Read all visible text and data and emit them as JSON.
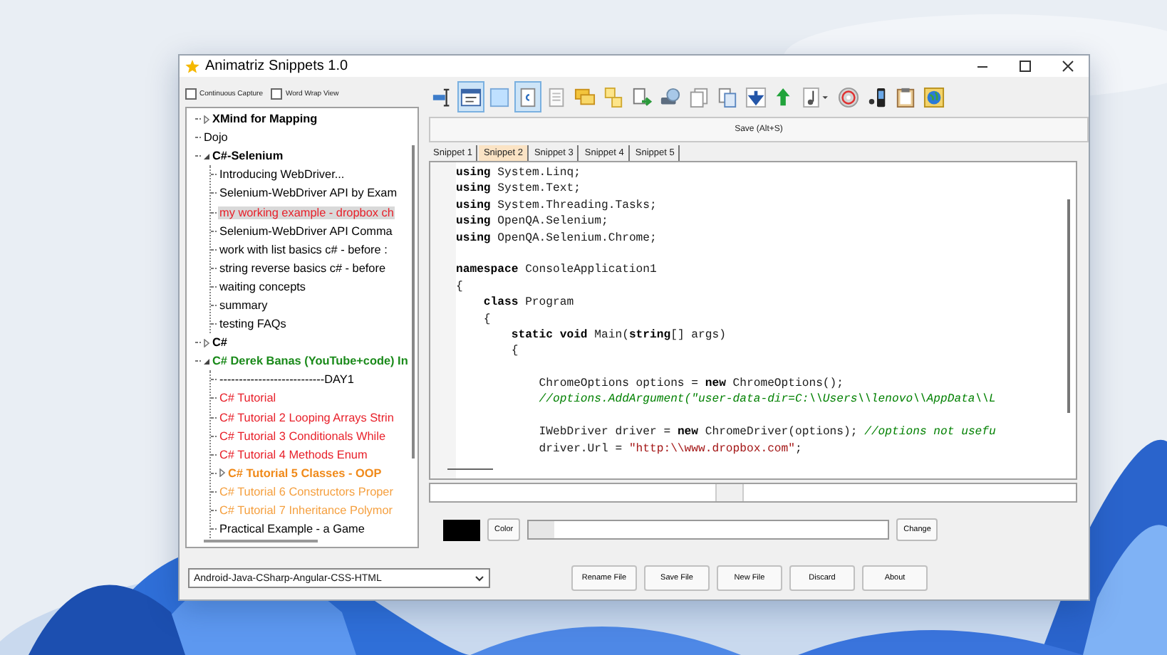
{
  "window": {
    "title": "Animatriz Snippets 1.0"
  },
  "options": [
    {
      "label": "Continuous Capture",
      "checked": false
    },
    {
      "label": "Word Wrap View",
      "checked": false
    }
  ],
  "tree": [
    {
      "label": "XMind for Mapping",
      "bold": true,
      "color": "#000000",
      "expanded": false,
      "selected": false
    },
    {
      "label": "Dojo",
      "bold": false,
      "color": "#000000",
      "selected": false
    },
    {
      "label": "C#-Selenium",
      "bold": true,
      "color": "#000000",
      "expanded": true,
      "selected": false,
      "children": [
        {
          "label": "Introducing WebDriver...",
          "bold": false,
          "color": "#000000",
          "selected": false
        },
        {
          "label": "Selenium-WebDriver API by Exam",
          "bold": false,
          "color": "#000000",
          "selected": false
        },
        {
          "label": "my working example - dropbox ch",
          "bold": false,
          "color": "#e8202a",
          "selected": true
        },
        {
          "label": "Selenium-WebDriver API Comma",
          "bold": false,
          "color": "#000000",
          "selected": false
        },
        {
          "label": "work with list basics c# - before :",
          "bold": false,
          "color": "#000000",
          "selected": false
        },
        {
          "label": "string reverse basics c# - before",
          "bold": false,
          "color": "#000000",
          "selected": false
        },
        {
          "label": "waiting concepts",
          "bold": false,
          "color": "#000000",
          "selected": false
        },
        {
          "label": "summary",
          "bold": false,
          "color": "#000000",
          "selected": false
        },
        {
          "label": "testing FAQs",
          "bold": false,
          "color": "#000000",
          "selected": false
        }
      ]
    },
    {
      "label": "C#",
      "bold": true,
      "color": "#000000",
      "expanded": false,
      "selected": false
    },
    {
      "label": "C# Derek Banas (YouTube+code) In",
      "bold": true,
      "color": "#1a8a1a",
      "expanded": true,
      "selected": false,
      "children": [
        {
          "label": "---------------------------DAY1",
          "bold": false,
          "color": "#000000",
          "selected": false
        },
        {
          "label": "C# Tutorial",
          "bold": false,
          "color": "#e8202a",
          "selected": false
        },
        {
          "label": "C# Tutorial 2 Looping Arrays Strin",
          "bold": false,
          "color": "#e8202a",
          "selected": false
        },
        {
          "label": "C# Tutorial 3 Conditionals While",
          "bold": false,
          "color": "#e8202a",
          "selected": false
        },
        {
          "label": "C# Tutorial 4 Methods Enum",
          "bold": false,
          "color": "#e8202a",
          "selected": false
        },
        {
          "label": "C# Tutorial 5 Classes - OOP",
          "bold": true,
          "color": "#f08a1a",
          "expanded": false,
          "selected": false
        },
        {
          "label": "C# Tutorial 6 Constructors Proper",
          "bold": false,
          "color": "#f5a040",
          "selected": false
        },
        {
          "label": "C# Tutorial 7 Inheritance Polymor",
          "bold": false,
          "color": "#f5a040",
          "selected": false
        },
        {
          "label": "Practical Example - a Game",
          "bold": false,
          "color": "#000000",
          "selected": false
        }
      ]
    }
  ],
  "toolbar": [
    {
      "kind": "ruler",
      "pressed": false
    },
    {
      "kind": "window",
      "pressed": true
    },
    {
      "kind": "frame",
      "pressed": false
    },
    {
      "kind": "csharp",
      "pressed": true
    },
    {
      "kind": "page",
      "pressed": false
    },
    {
      "kind": "chat",
      "pressed": false
    },
    {
      "kind": "notes",
      "pressed": false
    },
    {
      "kind": "export",
      "pressed": false
    },
    {
      "kind": "disk",
      "pressed": false
    },
    {
      "kind": "pages",
      "pressed": false
    },
    {
      "kind": "copy",
      "pressed": false
    },
    {
      "kind": "down",
      "pressed": false
    },
    {
      "kind": "up",
      "pressed": false
    },
    {
      "kind": "music",
      "pressed": false
    },
    {
      "kind": "disc",
      "pressed": false
    },
    {
      "kind": "phone",
      "pressed": false
    },
    {
      "kind": "clipboard",
      "pressed": false
    },
    {
      "kind": "globe",
      "pressed": false
    }
  ],
  "save_button": "Save (Alt+S)",
  "tabs": [
    {
      "label": "Snippet 1",
      "selected": false
    },
    {
      "label": "Snippet 2",
      "selected": true
    },
    {
      "label": "Snippet 3",
      "selected": false
    },
    {
      "label": "Snippet 4",
      "selected": false
    },
    {
      "label": "Snippet 5",
      "selected": false
    }
  ],
  "code": [
    {
      "kind": "code",
      "segments": [
        {
          "kind": "keyword",
          "text": "using"
        },
        {
          "kind": "plain",
          "text": " System.Linq;"
        }
      ]
    },
    {
      "kind": "code",
      "segments": [
        {
          "kind": "keyword",
          "text": "using"
        },
        {
          "kind": "plain",
          "text": " System.Text;"
        }
      ]
    },
    {
      "kind": "code",
      "segments": [
        {
          "kind": "keyword",
          "text": "using"
        },
        {
          "kind": "plain",
          "text": " System.Threading.Tasks;"
        }
      ]
    },
    {
      "kind": "code",
      "segments": [
        {
          "kind": "keyword",
          "text": "using"
        },
        {
          "kind": "plain",
          "text": " OpenQA.Selenium;"
        }
      ]
    },
    {
      "kind": "code",
      "segments": [
        {
          "kind": "keyword",
          "text": "using"
        },
        {
          "kind": "plain",
          "text": " OpenQA.Selenium.Chrome;"
        }
      ]
    },
    {
      "kind": "blank"
    },
    {
      "kind": "code",
      "segments": [
        {
          "kind": "keyword",
          "text": "namespace"
        },
        {
          "kind": "plain",
          "text": " ConsoleApplication1"
        }
      ]
    },
    {
      "kind": "code",
      "segments": [
        {
          "kind": "plain",
          "text": "{"
        }
      ]
    },
    {
      "kind": "code",
      "segments": [
        {
          "kind": "keyword",
          "text": "    class"
        },
        {
          "kind": "plain",
          "text": " Program"
        }
      ]
    },
    {
      "kind": "code",
      "segments": [
        {
          "kind": "plain",
          "text": "    {"
        }
      ]
    },
    {
      "kind": "code",
      "segments": [
        {
          "kind": "keyword",
          "text": "        static void"
        },
        {
          "kind": "plain",
          "text": " Main("
        },
        {
          "kind": "keyword",
          "text": "string"
        },
        {
          "kind": "plain",
          "text": "[] args)"
        }
      ]
    },
    {
      "kind": "code",
      "segments": [
        {
          "kind": "plain",
          "text": "        {"
        }
      ]
    },
    {
      "kind": "blank"
    },
    {
      "kind": "code",
      "segments": [
        {
          "kind": "plain",
          "text": "            ChromeOptions options = "
        },
        {
          "kind": "keyword",
          "text": "new"
        },
        {
          "kind": "plain",
          "text": " ChromeOptions();"
        }
      ]
    },
    {
      "kind": "code",
      "segments": [
        {
          "kind": "comment",
          "text": "            //options.AddArgument(\"user-data-dir=C:\\\\Users\\\\lenovo\\\\AppData\\\\L"
        }
      ]
    },
    {
      "kind": "blank"
    },
    {
      "kind": "code",
      "segments": [
        {
          "kind": "plain",
          "text": "            IWebDriver driver = "
        },
        {
          "kind": "keyword",
          "text": "new"
        },
        {
          "kind": "plain",
          "text": " ChromeDriver(options); "
        },
        {
          "kind": "comment",
          "text": "//options not usefu"
        }
      ]
    },
    {
      "kind": "code",
      "segments": [
        {
          "kind": "plain",
          "text": "            driver.Url = "
        },
        {
          "kind": "string",
          "text": "\"http:\\\\www.dropbox.com\""
        },
        {
          "kind": "plain",
          "text": ";"
        }
      ]
    }
  ],
  "color_row": {
    "button": "Color",
    "progress": {
      "level": 0.07
    },
    "change_button": "Change"
  },
  "language_select": "Android-Java-CSharp-Angular-CSS-HTML",
  "buttons": [
    "Rename File",
    "Save File",
    "New File",
    "Discard",
    "About"
  ]
}
